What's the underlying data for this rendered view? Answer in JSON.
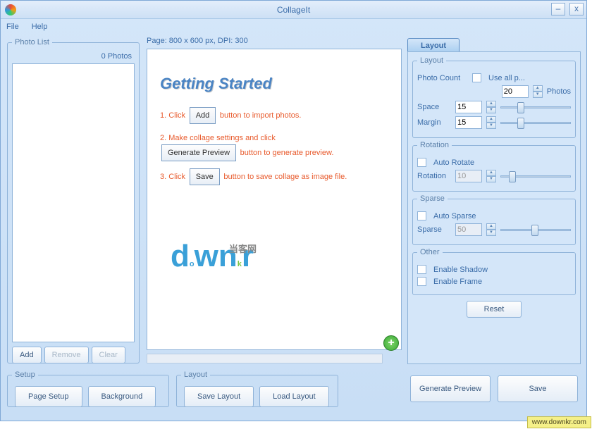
{
  "title": "CollageIt",
  "menu": {
    "file": "File",
    "help": "Help"
  },
  "photolist": {
    "legend": "Photo List",
    "count": "0 Photos",
    "add": "Add",
    "remove": "Remove",
    "clear": "Clear"
  },
  "pageinfo": "Page: 800 x 600 px, DPI: 300",
  "getting_started": {
    "heading": "Getting Started",
    "s1a": "1. Click",
    "s1btn": "Add",
    "s1b": " button to import photos.",
    "s2a": "2. Make collage settings and click",
    "s2btn": "Generate Preview",
    "s2b": " button to generate preview.",
    "s3a": "3. Click",
    "s3btn": "Save",
    "s3b": " button to save collage as image file."
  },
  "tab": "Layout",
  "layout_group": {
    "legend": "Layout",
    "photo_count_lbl": "Photo Count",
    "use_all": "Use all p...",
    "count_val": "20",
    "count_unit": "Photos",
    "space_lbl": "Space",
    "space_val": "15",
    "margin_lbl": "Margin",
    "margin_val": "15"
  },
  "rotation": {
    "legend": "Rotation",
    "auto": "Auto Rotate",
    "lbl": "Rotation",
    "val": "10"
  },
  "sparse": {
    "legend": "Sparse",
    "auto": "Auto Sparse",
    "lbl": "Sparse",
    "val": "50"
  },
  "other": {
    "legend": "Other",
    "shadow": "Enable Shadow",
    "frame": "Enable Frame"
  },
  "reset": "Reset",
  "setup": {
    "legend": "Setup",
    "page": "Page Setup",
    "bg": "Background"
  },
  "layout_btns": {
    "legend": "Layout",
    "save": "Save Layout",
    "load": "Load Layout"
  },
  "bottom": {
    "gen": "Generate Preview",
    "save": "Save"
  },
  "badge": "www.downkr.com"
}
